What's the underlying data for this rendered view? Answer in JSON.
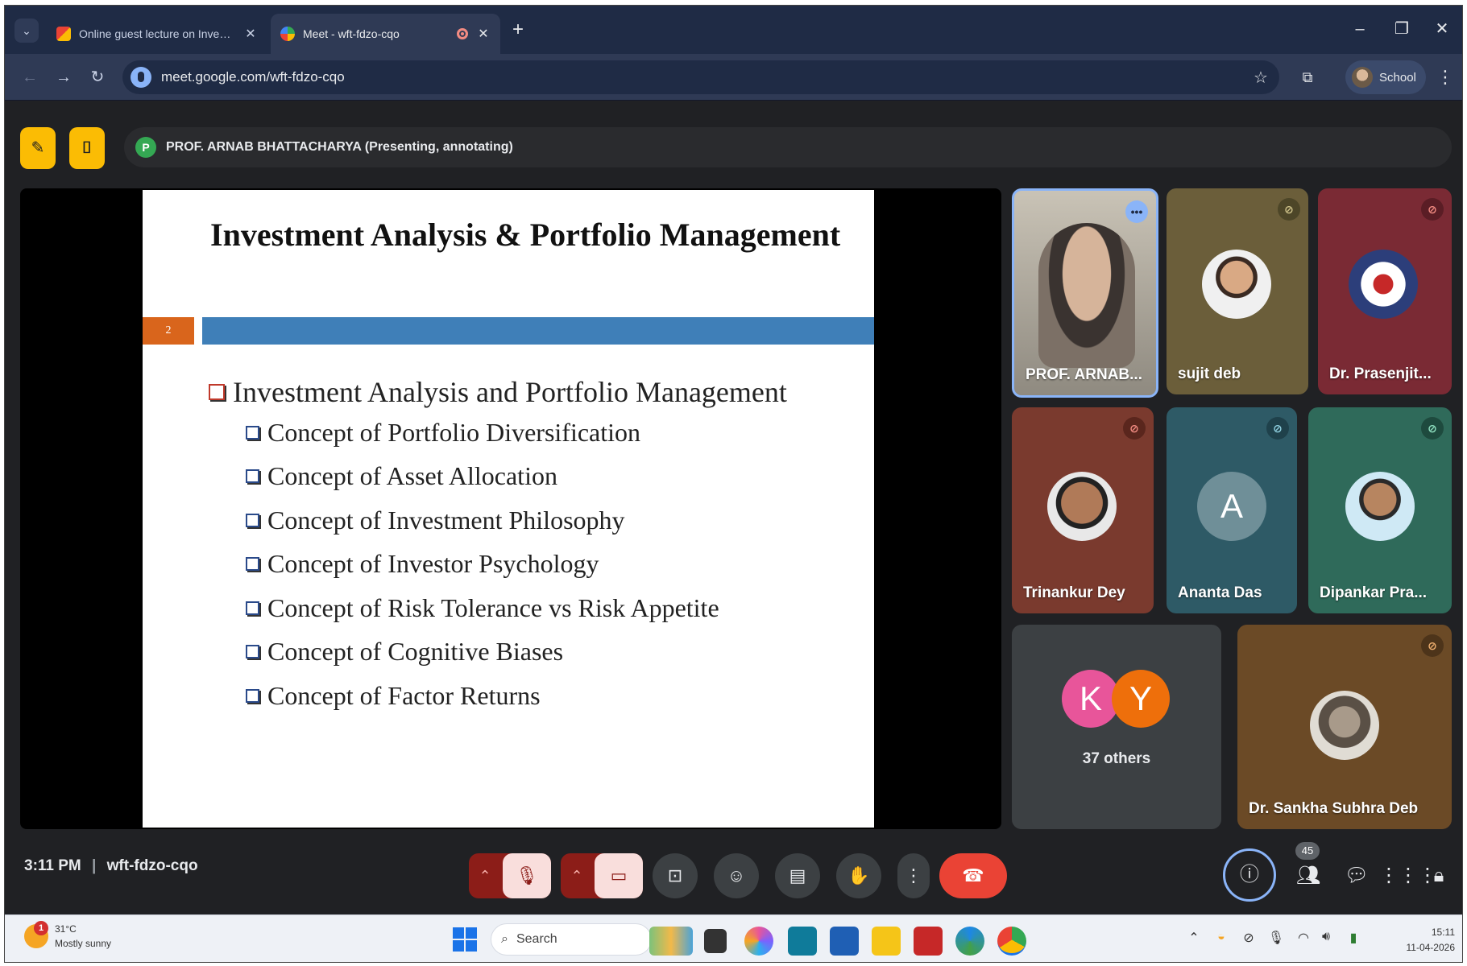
{
  "browser": {
    "tabs": [
      {
        "title": "Online guest lecture on Investm",
        "favicon": "gmail-icon",
        "active": false
      },
      {
        "title": "Meet - wft-fdzo-cqo",
        "favicon": "meet-icon",
        "active": true
      }
    ],
    "url": "meet.google.com/wft-fdzo-cqo",
    "profile_label": "School"
  },
  "meet": {
    "presenter_initial": "P",
    "presenter_text": "PROF. ARNAB BHATTACHARYA (Presenting, annotating)",
    "slide": {
      "title": "Investment Analysis & Portfolio Management",
      "number": "2",
      "main_item": "Investment Analysis and Portfolio Management",
      "sub_items": [
        "Concept of Portfolio Diversification",
        "Concept of Asset Allocation",
        "Concept of Investment Philosophy",
        "Concept of Investor Psychology",
        "Concept of Risk Tolerance vs Risk Appetite",
        "Concept of Cognitive Biases",
        "Concept of Factor Returns"
      ]
    },
    "participants": [
      {
        "name": "PROF. ARNAB...",
        "muted": false,
        "speaking": true
      },
      {
        "name": "sujit deb",
        "muted": true
      },
      {
        "name": "Dr. Prasenjit...",
        "muted": true
      },
      {
        "name": "Trinankur Dey",
        "muted": true
      },
      {
        "name": "Ananta Das",
        "initial": "A",
        "muted": true
      },
      {
        "name": "Dipankar Pra...",
        "muted": true
      },
      {
        "name": "Dr. Sankha Subhra Deb",
        "muted": true
      }
    ],
    "others": {
      "label": "37 others",
      "initials": [
        "K",
        "Y"
      ]
    },
    "time": "3:11 PM",
    "meeting_code": "wft-fdzo-cqo",
    "people_count": "45"
  },
  "taskbar": {
    "weather_temp": "31°C",
    "weather_desc": "Mostly sunny",
    "weather_badge": "1",
    "search_placeholder": "Search",
    "time": "15:11",
    "date": "11-04-2026"
  },
  "colors": {
    "tabstrip": "#1f2b45",
    "toolbar": "#2f3a55",
    "meet_bg": "#202124",
    "accent_yellow": "#fbbc04",
    "hangup_red": "#ea4335",
    "slide_band_blue": "#3f7fb8",
    "slide_num_orange": "#d9651c"
  }
}
